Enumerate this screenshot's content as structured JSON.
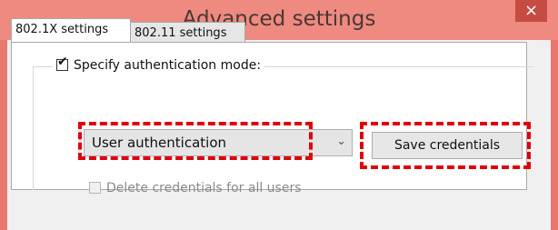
{
  "window": {
    "title": "Advanced settings",
    "close_glyph": "×"
  },
  "tabs": [
    {
      "label": "802.1X settings",
      "active": true
    },
    {
      "label": "802.11 settings",
      "active": false
    }
  ],
  "auth": {
    "specify_label": "Specify authentication mode:",
    "specify_checked": true,
    "mode_value": "User authentication",
    "save_button": "Save credentials",
    "delete_label": "Delete credentials for all users",
    "delete_checked": false,
    "delete_enabled": false
  },
  "colors": {
    "titlebar": "#ee8a80",
    "highlight": "#e0000b"
  },
  "icons": {
    "close": "close-icon",
    "dropdown": "chevron-down-icon",
    "check": "check-icon"
  }
}
